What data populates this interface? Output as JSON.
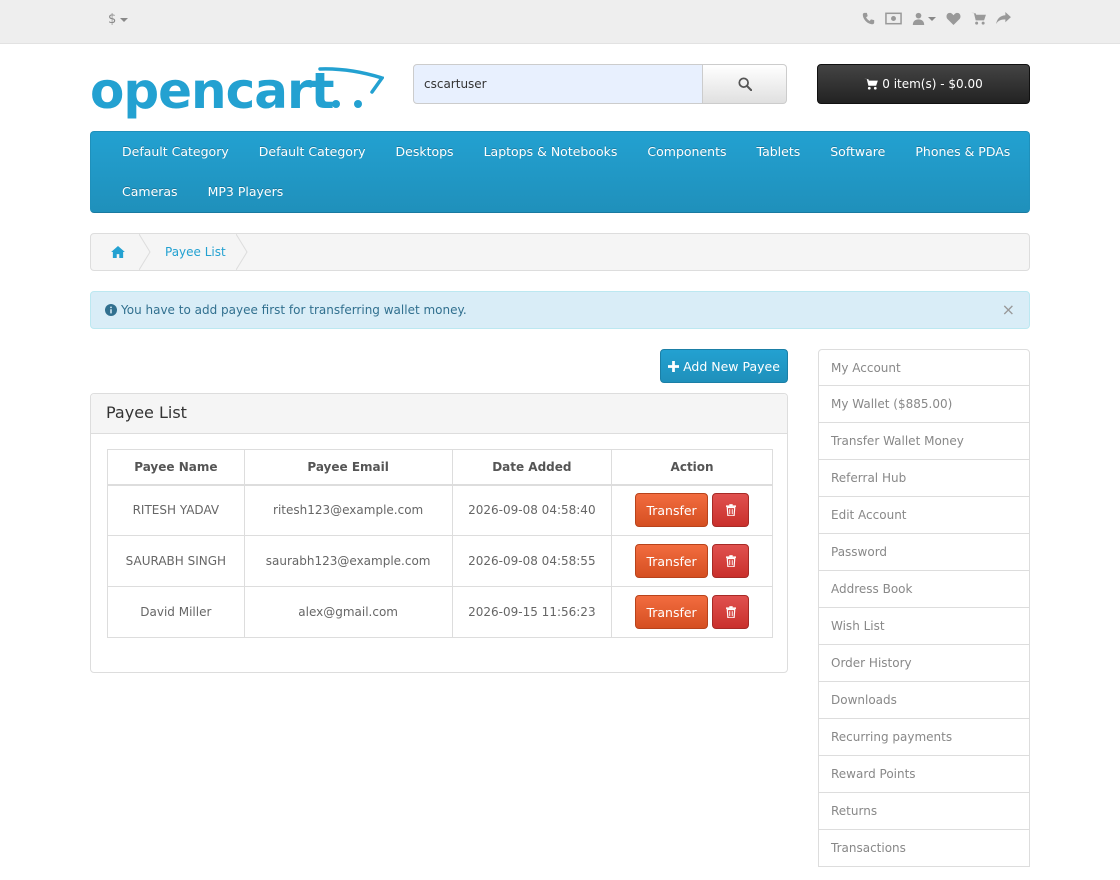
{
  "topbar": {
    "currency_symbol": "$",
    "icons": [
      "phone-icon",
      "money-icon",
      "user-icon",
      "heart-icon",
      "cart-icon",
      "share-icon"
    ]
  },
  "header": {
    "logo_text": "opencart",
    "search": {
      "value": "cscartuser",
      "placeholder": "Search"
    },
    "cart_label": "0 item(s) - $0.00"
  },
  "menu": {
    "items": [
      "Default Category",
      "Default Category",
      "Desktops",
      "Laptops & Notebooks",
      "Components",
      "Tablets",
      "Software",
      "Phones & PDAs",
      "Cameras",
      "MP3 Players"
    ]
  },
  "breadcrumb": {
    "current": "Payee List"
  },
  "alert": {
    "message": "You have to add payee first for transferring wallet money.",
    "close": "×"
  },
  "add_button": "Add New Payee",
  "panel": {
    "title": "Payee List",
    "columns": [
      "Payee Name",
      "Payee Email",
      "Date Added",
      "Action"
    ],
    "transfer_label": "Transfer",
    "rows": [
      {
        "name": "RITESH YADAV",
        "email": "ritesh123@example.com",
        "date": "2026-09-08 04:58:40"
      },
      {
        "name": "SAURABH SINGH",
        "email": "saurabh123@example.com",
        "date": "2026-09-08 04:58:55"
      },
      {
        "name": "David Miller",
        "email": "alex@gmail.com",
        "date": "2026-09-15 11:56:23"
      }
    ]
  },
  "sidebar": {
    "items": [
      "My Account",
      "My Wallet ($885.00)",
      "Transfer Wallet Money",
      "Referral Hub",
      "Edit Account",
      "Password",
      "Address Book",
      "Wish List",
      "Order History",
      "Downloads",
      "Recurring payments",
      "Reward Points",
      "Returns",
      "Transactions"
    ]
  },
  "colors": {
    "brand_blue": "#23a1d1",
    "danger_orange": "#e35d2e",
    "danger_red": "#d43f3a"
  }
}
